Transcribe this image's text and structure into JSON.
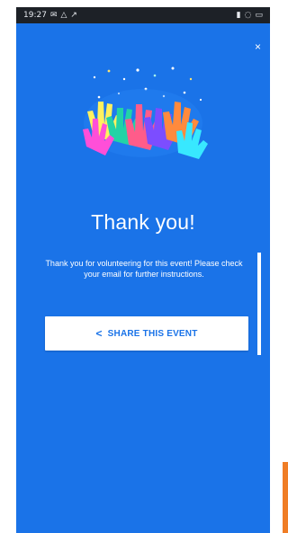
{
  "status_bar": {
    "time": "19:27",
    "left_icons": [
      "mail-icon",
      "alert-icon",
      "send-icon"
    ],
    "right_icons": [
      "signal-icon",
      "wifi-icon",
      "battery-icon"
    ]
  },
  "dialog": {
    "close_label": "×",
    "title": "Thank you!",
    "message": "Thank you for volunteering for this event! Please check your email for further instructions.",
    "share_button": {
      "icon": "share-icon",
      "label": "SHARE THIS EVENT"
    }
  },
  "colors": {
    "background": "#1a73e8",
    "status_bar": "#1d2127",
    "button": "#ffffff",
    "button_text": "#1a73e8",
    "accent_strip": "#f07d25"
  }
}
